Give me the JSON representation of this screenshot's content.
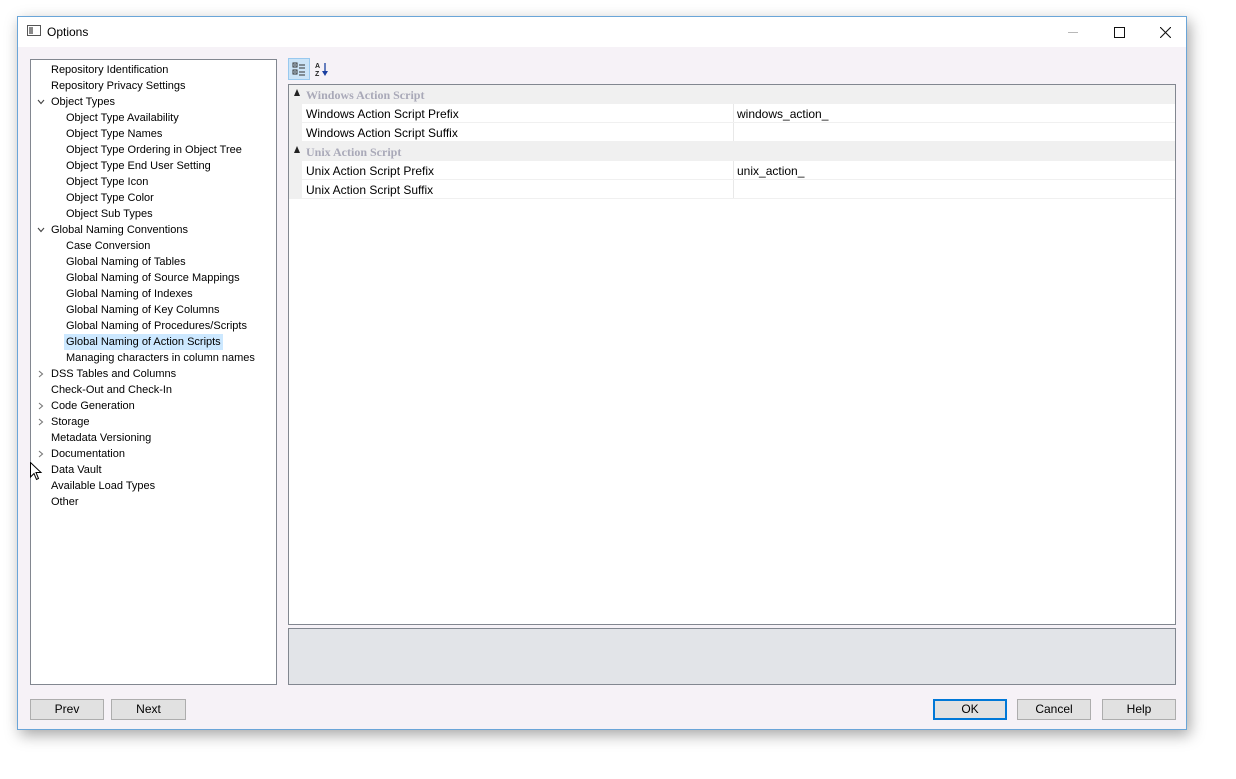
{
  "window": {
    "title": "Options"
  },
  "titlebar": {
    "minimize_glyph": "—",
    "maximize_glyph": "☐",
    "close_glyph": "✕"
  },
  "tree": {
    "items": [
      {
        "label": "Repository Identification",
        "level": 0,
        "expander": "none"
      },
      {
        "label": "Repository Privacy Settings",
        "level": 0,
        "expander": "none"
      },
      {
        "label": "Object Types",
        "level": 0,
        "expander": "expanded"
      },
      {
        "label": "Object Type Availability",
        "level": 1,
        "expander": "none"
      },
      {
        "label": "Object Type Names",
        "level": 1,
        "expander": "none"
      },
      {
        "label": "Object Type Ordering in Object Tree",
        "level": 1,
        "expander": "none"
      },
      {
        "label": "Object Type End User Setting",
        "level": 1,
        "expander": "none"
      },
      {
        "label": "Object Type Icon",
        "level": 1,
        "expander": "none"
      },
      {
        "label": "Object Type Color",
        "level": 1,
        "expander": "none"
      },
      {
        "label": "Object Sub Types",
        "level": 1,
        "expander": "none"
      },
      {
        "label": "Global Naming Conventions",
        "level": 0,
        "expander": "expanded"
      },
      {
        "label": "Case Conversion",
        "level": 1,
        "expander": "none"
      },
      {
        "label": "Global Naming of Tables",
        "level": 1,
        "expander": "none"
      },
      {
        "label": "Global Naming of Source Mappings",
        "level": 1,
        "expander": "none"
      },
      {
        "label": "Global Naming of Indexes",
        "level": 1,
        "expander": "none"
      },
      {
        "label": "Global Naming of Key Columns",
        "level": 1,
        "expander": "none"
      },
      {
        "label": "Global Naming of Procedures/Scripts",
        "level": 1,
        "expander": "none"
      },
      {
        "label": "Global Naming of Action Scripts",
        "level": 1,
        "expander": "none",
        "selected": true
      },
      {
        "label": "Managing characters in column names",
        "level": 1,
        "expander": "none"
      },
      {
        "label": "DSS Tables and Columns",
        "level": 0,
        "expander": "collapsed"
      },
      {
        "label": "Check-Out and Check-In",
        "level": 0,
        "expander": "none"
      },
      {
        "label": "Code Generation",
        "level": 0,
        "expander": "collapsed"
      },
      {
        "label": "Storage",
        "level": 0,
        "expander": "collapsed"
      },
      {
        "label": "Metadata Versioning",
        "level": 0,
        "expander": "none"
      },
      {
        "label": "Documentation",
        "level": 0,
        "expander": "collapsed"
      },
      {
        "label": "Data Vault",
        "level": 0,
        "expander": "none"
      },
      {
        "label": "Available Load Types",
        "level": 0,
        "expander": "none"
      },
      {
        "label": "Other",
        "level": 0,
        "expander": "none"
      }
    ]
  },
  "toolbar": {
    "categorized_icon": "categorized-icon",
    "alphabetical_icon": "sort-az-icon",
    "active": "categorized"
  },
  "property_grid": {
    "categories": [
      {
        "name": "Windows Action Script",
        "properties": [
          {
            "name": "Windows Action Script Prefix",
            "value": "windows_action_"
          },
          {
            "name": "Windows Action Script Suffix",
            "value": ""
          }
        ]
      },
      {
        "name": "Unix Action Script",
        "properties": [
          {
            "name": "Unix Action Script Prefix",
            "value": "unix_action_"
          },
          {
            "name": "Unix Action Script Suffix",
            "value": ""
          }
        ]
      }
    ]
  },
  "buttons": {
    "prev": "Prev",
    "next": "Next",
    "ok": "OK",
    "cancel": "Cancel",
    "help": "Help"
  },
  "colors": {
    "selection": "#cce8ff",
    "accent": "#0078d7",
    "category_text": "#a9a9b8"
  }
}
